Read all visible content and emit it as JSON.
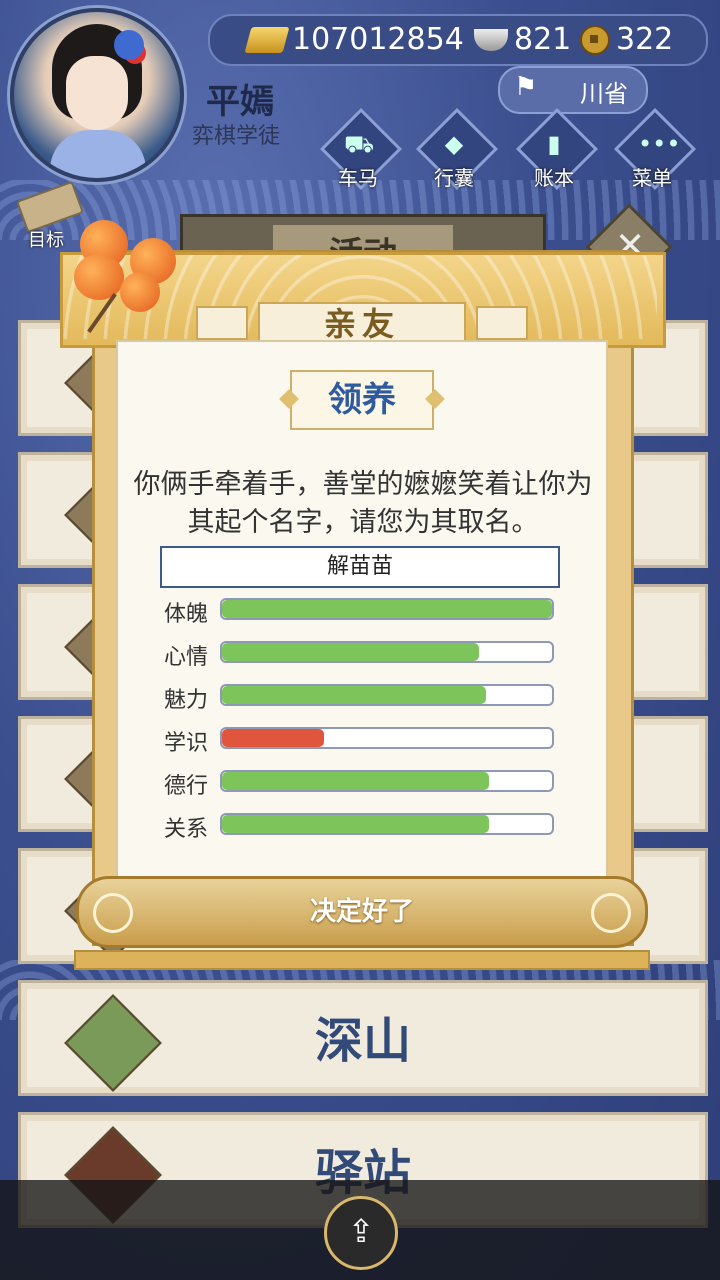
{
  "hud": {
    "currency_gold": "107012854",
    "currency_silver": "821",
    "currency_coin": "322",
    "player_name": "平嫣",
    "player_title": "弈棋学徒",
    "province": "川省",
    "nav": [
      "车马",
      "行囊",
      "账本",
      "菜单"
    ],
    "goal_label": "目标"
  },
  "tab": {
    "activity_label": "活动"
  },
  "locations": {
    "mountain": "深山",
    "post_station": "驿站"
  },
  "modal": {
    "header": "亲友",
    "subtitle": "领养",
    "message": "你俩手牵着手，善堂的嬷嬷笑着让你为其起个名字，请您为其取名。",
    "name_value": "解苗苗",
    "confirm_label": "决定好了",
    "stats": [
      {
        "label": "体魄",
        "value": 1.0,
        "color": "#7dc55a"
      },
      {
        "label": "心情",
        "value": 0.78,
        "color": "#7dc55a"
      },
      {
        "label": "魅力",
        "value": 0.8,
        "color": "#7dc55a"
      },
      {
        "label": "学识",
        "value": 0.31,
        "color": "#e0553d"
      },
      {
        "label": "德行",
        "value": 0.81,
        "color": "#7dc55a"
      },
      {
        "label": "关系",
        "value": 0.81,
        "color": "#7dc55a"
      }
    ]
  }
}
